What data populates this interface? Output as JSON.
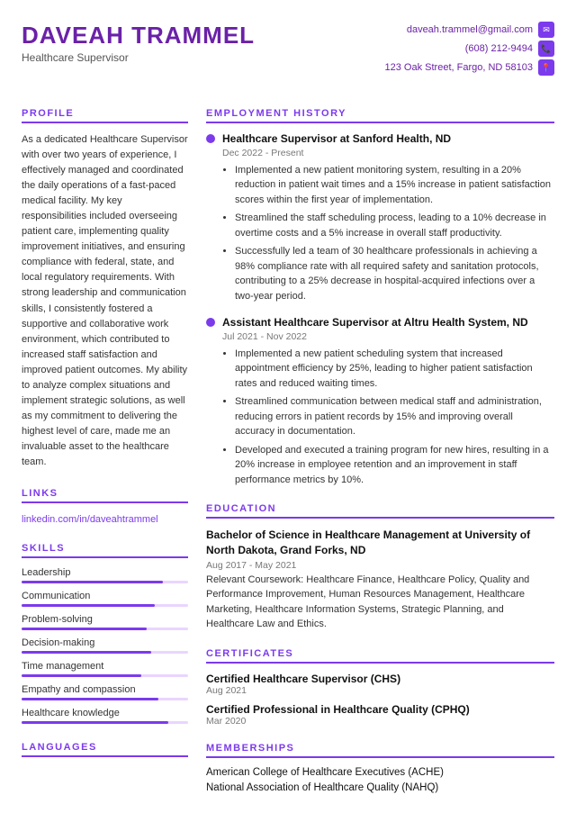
{
  "header": {
    "name": "DAVEAH TRAMMEL",
    "title": "Healthcare Supervisor",
    "email": "daveah.trammel@gmail.com",
    "phone": "(608) 212-9494",
    "address": "123 Oak Street, Fargo, ND 58103"
  },
  "profile": {
    "heading": "PROFILE",
    "text": "As a dedicated Healthcare Supervisor with over two years of experience, I effectively managed and coordinated the daily operations of a fast-paced medical facility. My key responsibilities included overseeing patient care, implementing quality improvement initiatives, and ensuring compliance with federal, state, and local regulatory requirements. With strong leadership and communication skills, I consistently fostered a supportive and collaborative work environment, which contributed to increased staff satisfaction and improved patient outcomes. My ability to analyze complex situations and implement strategic solutions, as well as my commitment to delivering the highest level of care, made me an invaluable asset to the healthcare team."
  },
  "links": {
    "heading": "LINKS",
    "items": [
      {
        "label": "linkedin.com/in/daveahtrammel",
        "url": "#"
      }
    ]
  },
  "skills": {
    "heading": "SKILLS",
    "items": [
      {
        "name": "Leadership",
        "pct": 85
      },
      {
        "name": "Communication",
        "pct": 80
      },
      {
        "name": "Problem-solving",
        "pct": 75
      },
      {
        "name": "Decision-making",
        "pct": 78
      },
      {
        "name": "Time management",
        "pct": 72
      },
      {
        "name": "Empathy and compassion",
        "pct": 82
      },
      {
        "name": "Healthcare knowledge",
        "pct": 88
      }
    ]
  },
  "languages": {
    "heading": "LANGUAGES"
  },
  "employment": {
    "heading": "EMPLOYMENT HISTORY",
    "jobs": [
      {
        "title": "Healthcare Supervisor at Sanford Health, ND",
        "date": "Dec 2022 - Present",
        "bullets": [
          "Implemented a new patient monitoring system, resulting in a 20% reduction in patient wait times and a 15% increase in patient satisfaction scores within the first year of implementation.",
          "Streamlined the staff scheduling process, leading to a 10% decrease in overtime costs and a 5% increase in overall staff productivity.",
          "Successfully led a team of 30 healthcare professionals in achieving a 98% compliance rate with all required safety and sanitation protocols, contributing to a 25% decrease in hospital-acquired infections over a two-year period."
        ]
      },
      {
        "title": "Assistant Healthcare Supervisor at Altru Health System, ND",
        "date": "Jul 2021 - Nov 2022",
        "bullets": [
          "Implemented a new patient scheduling system that increased appointment efficiency by 25%, leading to higher patient satisfaction rates and reduced waiting times.",
          "Streamlined communication between medical staff and administration, reducing errors in patient records by 15% and improving overall accuracy in documentation.",
          "Developed and executed a training program for new hires, resulting in a 20% increase in employee retention and an improvement in staff performance metrics by 10%."
        ]
      }
    ]
  },
  "education": {
    "heading": "EDUCATION",
    "degree": "Bachelor of Science in Healthcare Management at University of North Dakota, Grand Forks, ND",
    "date": "Aug 2017 - May 2021",
    "desc": "Relevant Coursework: Healthcare Finance, Healthcare Policy, Quality and Performance Improvement, Human Resources Management, Healthcare Marketing, Healthcare Information Systems, Strategic Planning, and Healthcare Law and Ethics."
  },
  "certificates": {
    "heading": "CERTIFICATES",
    "items": [
      {
        "name": "Certified Healthcare Supervisor (CHS)",
        "date": "Aug 2021"
      },
      {
        "name": "Certified Professional in Healthcare Quality (CPHQ)",
        "date": "Mar 2020"
      }
    ]
  },
  "memberships": {
    "heading": "MEMBERSHIPS",
    "items": [
      "American College of Healthcare Executives (ACHE)",
      "National Association of Healthcare Quality (NAHQ)"
    ]
  }
}
